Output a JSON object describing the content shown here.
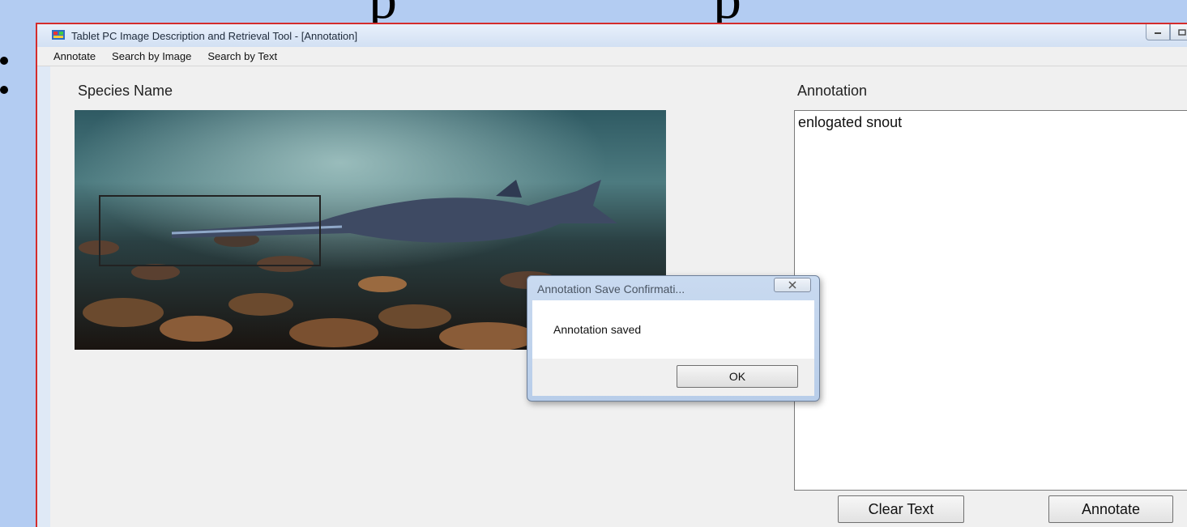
{
  "window": {
    "title": "Tablet PC Image Description and Retrieval Tool - [Annotation]",
    "controls": [
      "minimize-icon",
      "maximize-icon",
      "close-icon"
    ]
  },
  "menu": {
    "items": [
      "Annotate",
      "Search by Image",
      "Search by Text"
    ]
  },
  "main": {
    "species_label": "Species Name",
    "annotation_label": "Annotation",
    "annotation_text": "enlogated snout",
    "clear_button": "Clear Text",
    "annotate_button": "Annotate"
  },
  "dialog": {
    "title": "Annotation Save Confirmati...",
    "message": "Annotation saved",
    "ok_button": "OK"
  },
  "colors": {
    "window_border": "#d42c2c",
    "background": "#b3ccf2"
  }
}
